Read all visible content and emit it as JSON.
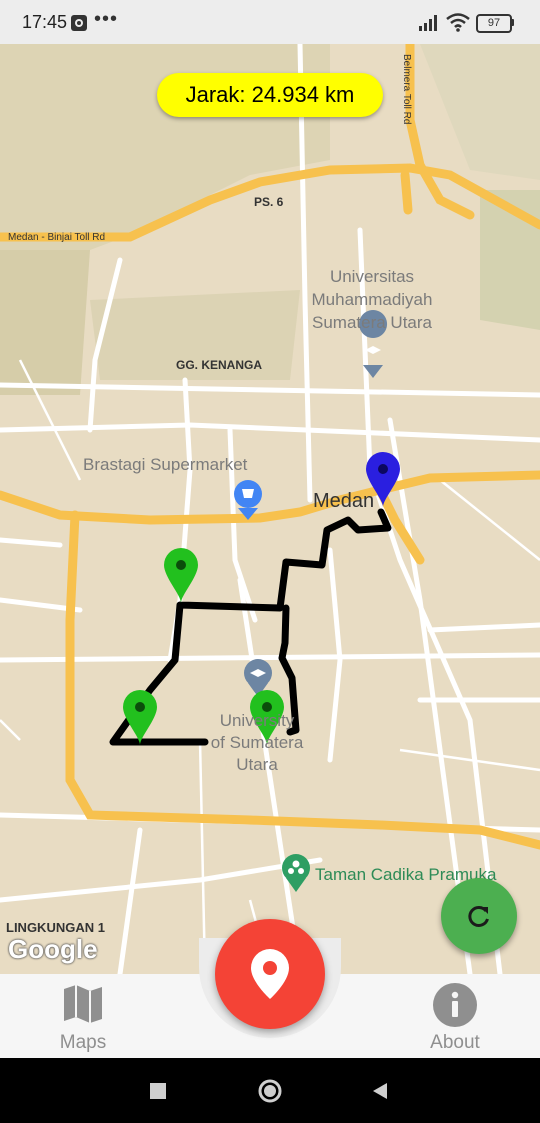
{
  "status_bar": {
    "time": "17:45",
    "notif_dots": "•••",
    "battery": "97"
  },
  "distance": {
    "text": "Jarak: 24.934 km"
  },
  "map": {
    "roads": {
      "ps6": "PS. 6",
      "toll_left": "Medan - Binjai Toll Rd",
      "belmera": "Belmera Toll Rd",
      "kenanga": "GG. KENANGA"
    },
    "pois": {
      "umsu_line1": "Universitas",
      "umsu_line2": "Muhammadiyah",
      "umsu_line3": "Sumatera Utara",
      "brastagi": "Brastagi Supermarket",
      "usu_line1": "University",
      "usu_line2": "of Sumatera",
      "usu_line3": "Utara",
      "taman": "Taman Cadika Pramuka",
      "city": "Medan",
      "area": "LINGKUNGAN 1"
    },
    "attribution": "Google",
    "colors": {
      "route": "#000000",
      "marker_green": "#22c01e",
      "marker_blue": "#2a1fe0"
    }
  },
  "bottom_nav": {
    "maps_label": "Maps",
    "about_label": "About"
  },
  "colors": {
    "accent_red": "#f44336",
    "fab_green": "#4caf50",
    "pill_yellow": "#ffff00"
  }
}
